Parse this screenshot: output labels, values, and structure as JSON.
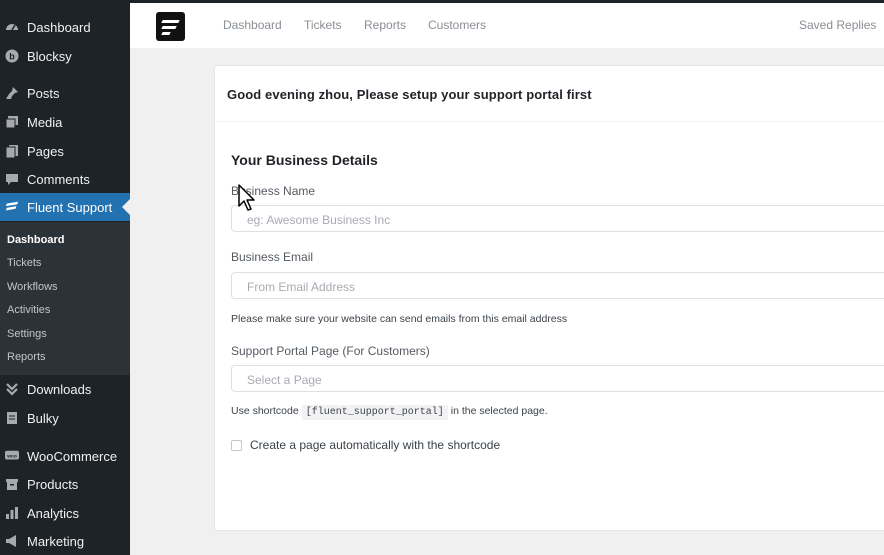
{
  "sidebar": {
    "items": [
      {
        "label": "Dashboard",
        "icon": "dashboard-icon"
      },
      {
        "label": "Blocksy",
        "icon": "blocksy-icon"
      },
      {
        "label": "Posts",
        "icon": "pin-icon"
      },
      {
        "label": "Media",
        "icon": "media-icon"
      },
      {
        "label": "Pages",
        "icon": "pages-icon"
      },
      {
        "label": "Comments",
        "icon": "comment-icon"
      },
      {
        "label": "Fluent Support",
        "icon": "fluent-support-icon"
      },
      {
        "label": "Downloads",
        "icon": "downloads-icon"
      },
      {
        "label": "Bulky",
        "icon": "bulky-icon"
      },
      {
        "label": "WooCommerce",
        "icon": "woocommerce-icon"
      },
      {
        "label": "Products",
        "icon": "products-icon"
      },
      {
        "label": "Analytics",
        "icon": "analytics-icon"
      },
      {
        "label": "Marketing",
        "icon": "marketing-icon"
      }
    ],
    "submenu": [
      "Dashboard",
      "Tickets",
      "Workflows",
      "Activities",
      "Settings",
      "Reports"
    ],
    "accent": "#2271b1"
  },
  "topnav": {
    "items": [
      "Dashboard",
      "Tickets",
      "Reports",
      "Customers"
    ],
    "right": "Saved Replies"
  },
  "setup": {
    "greeting": "Good evening zhou, Please setup your support portal first",
    "section_title": "Your Business Details",
    "business_name_label": "Business Name",
    "business_name_placeholder": "eg: Awesome Business Inc",
    "business_email_label": "Business Email",
    "business_email_placeholder": "From Email Address",
    "email_help": "Please make sure your website can send emails from this email address",
    "portal_label": "Support Portal Page (For Customers)",
    "portal_placeholder": "Select a Page",
    "shortcode_pre": "Use shortcode",
    "shortcode": "[fluent_support_portal]",
    "shortcode_post": "in the selected page.",
    "checkbox_label": "Create a page automatically with the shortcode"
  }
}
